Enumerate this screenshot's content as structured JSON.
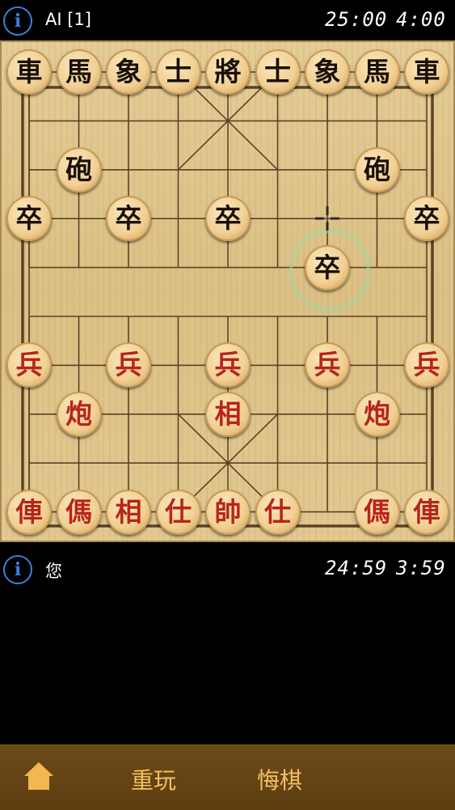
{
  "top_player": {
    "name": "AI [1]",
    "total_time": "25:00",
    "move_time": "4:00"
  },
  "bottom_player": {
    "name": "您",
    "total_time": "24:59",
    "move_time": "3:59"
  },
  "icons": {
    "info": "i"
  },
  "controls": {
    "restart_label": "重玩",
    "undo_label": "悔棋"
  },
  "colors": {
    "red_piece": "#b8241a",
    "black_piece": "#1a1008",
    "accent_button": "#f2c061",
    "bar": "#5d3e10"
  },
  "pieces": [
    {
      "char": "車",
      "side": "black",
      "col": 0,
      "row": 0
    },
    {
      "char": "馬",
      "side": "black",
      "col": 1,
      "row": 0
    },
    {
      "char": "象",
      "side": "black",
      "col": 2,
      "row": 0
    },
    {
      "char": "士",
      "side": "black",
      "col": 3,
      "row": 0
    },
    {
      "char": "將",
      "side": "black",
      "col": 4,
      "row": 0
    },
    {
      "char": "士",
      "side": "black",
      "col": 5,
      "row": 0
    },
    {
      "char": "象",
      "side": "black",
      "col": 6,
      "row": 0
    },
    {
      "char": "馬",
      "side": "black",
      "col": 7,
      "row": 0
    },
    {
      "char": "車",
      "side": "black",
      "col": 8,
      "row": 0
    },
    {
      "char": "砲",
      "side": "black",
      "col": 1,
      "row": 2
    },
    {
      "char": "砲",
      "side": "black",
      "col": 7,
      "row": 2
    },
    {
      "char": "卒",
      "side": "black",
      "col": 0,
      "row": 3
    },
    {
      "char": "卒",
      "side": "black",
      "col": 2,
      "row": 3
    },
    {
      "char": "卒",
      "side": "black",
      "col": 4,
      "row": 3
    },
    {
      "char": "卒",
      "side": "black",
      "col": 8,
      "row": 3
    },
    {
      "char": "卒",
      "side": "black",
      "col": 6,
      "row": 4
    },
    {
      "char": "兵",
      "side": "red",
      "col": 0,
      "row": 6
    },
    {
      "char": "兵",
      "side": "red",
      "col": 2,
      "row": 6
    },
    {
      "char": "兵",
      "side": "red",
      "col": 4,
      "row": 6
    },
    {
      "char": "兵",
      "side": "red",
      "col": 6,
      "row": 6
    },
    {
      "char": "兵",
      "side": "red",
      "col": 8,
      "row": 6
    },
    {
      "char": "炮",
      "side": "red",
      "col": 1,
      "row": 7
    },
    {
      "char": "相",
      "side": "red",
      "col": 4,
      "row": 7
    },
    {
      "char": "炮",
      "side": "red",
      "col": 7,
      "row": 7
    },
    {
      "char": "俥",
      "side": "red",
      "col": 0,
      "row": 9
    },
    {
      "char": "傌",
      "side": "red",
      "col": 1,
      "row": 9
    },
    {
      "char": "相",
      "side": "red",
      "col": 2,
      "row": 9
    },
    {
      "char": "仕",
      "side": "red",
      "col": 3,
      "row": 9
    },
    {
      "char": "帥",
      "side": "red",
      "col": 4,
      "row": 9
    },
    {
      "char": "仕",
      "side": "red",
      "col": 5,
      "row": 9
    },
    {
      "char": "傌",
      "side": "red",
      "col": 7,
      "row": 9
    },
    {
      "char": "俥",
      "side": "red",
      "col": 8,
      "row": 9
    }
  ],
  "last_move": {
    "from": {
      "col": 6,
      "row": 3
    },
    "to": {
      "col": 6,
      "row": 4
    }
  }
}
